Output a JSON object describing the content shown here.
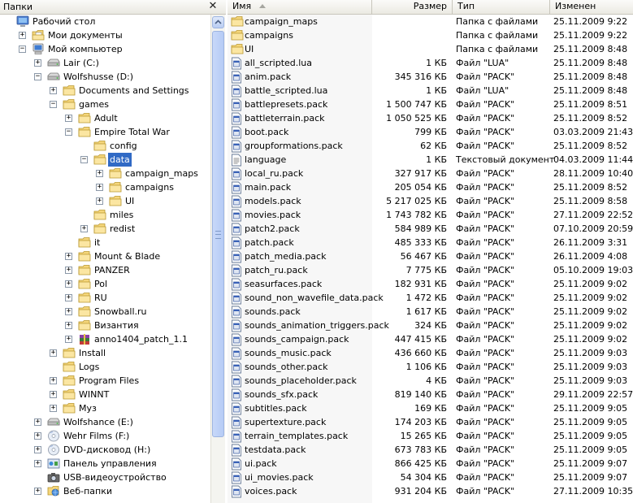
{
  "folders_pane": {
    "title": "Папки",
    "close_glyph": "✕"
  },
  "tree": [
    {
      "label": "Рабочий стол",
      "icon": "desktop-icon",
      "level": 0,
      "expander": ""
    },
    {
      "label": "Мои документы",
      "icon": "documents-icon",
      "level": 1,
      "expander": "+"
    },
    {
      "label": "Мой компьютер",
      "icon": "computer-icon",
      "level": 1,
      "expander": "−"
    },
    {
      "label": "Lair (C:)",
      "icon": "drive-icon",
      "level": 2,
      "expander": "+"
    },
    {
      "label": "Wolfshusse (D:)",
      "icon": "drive-icon",
      "level": 2,
      "expander": "−"
    },
    {
      "label": "Documents and Settings",
      "icon": "folder-icon",
      "level": 3,
      "expander": "+"
    },
    {
      "label": "games",
      "icon": "folder-icon",
      "level": 3,
      "expander": "−"
    },
    {
      "label": "Adult",
      "icon": "folder-icon",
      "level": 4,
      "expander": "+"
    },
    {
      "label": "Empire Total War",
      "icon": "folder-icon",
      "level": 4,
      "expander": "−"
    },
    {
      "label": "config",
      "icon": "folder-icon",
      "level": 5,
      "expander": ""
    },
    {
      "label": "data",
      "icon": "folder-icon",
      "level": 5,
      "expander": "−",
      "selected": true
    },
    {
      "label": "campaign_maps",
      "icon": "folder-icon",
      "level": 6,
      "expander": "+"
    },
    {
      "label": "campaigns",
      "icon": "folder-icon",
      "level": 6,
      "expander": "+"
    },
    {
      "label": "UI",
      "icon": "folder-icon",
      "level": 6,
      "expander": "+"
    },
    {
      "label": "miles",
      "icon": "folder-icon",
      "level": 5,
      "expander": ""
    },
    {
      "label": "redist",
      "icon": "folder-icon",
      "level": 5,
      "expander": "+"
    },
    {
      "label": "it",
      "icon": "folder-icon",
      "level": 4,
      "expander": ""
    },
    {
      "label": "Mount & Blade",
      "icon": "folder-icon",
      "level": 4,
      "expander": "+"
    },
    {
      "label": "PANZER",
      "icon": "folder-icon",
      "level": 4,
      "expander": "+"
    },
    {
      "label": "Pol",
      "icon": "folder-icon",
      "level": 4,
      "expander": "+"
    },
    {
      "label": "RU",
      "icon": "folder-icon",
      "level": 4,
      "expander": "+"
    },
    {
      "label": "Snowball.ru",
      "icon": "folder-icon",
      "level": 4,
      "expander": "+"
    },
    {
      "label": "Византия",
      "icon": "folder-icon",
      "level": 4,
      "expander": "+"
    },
    {
      "label": "anno1404_patch_1.1",
      "icon": "archive-icon",
      "level": 4,
      "expander": "+"
    },
    {
      "label": "Install",
      "icon": "folder-icon",
      "level": 3,
      "expander": "+"
    },
    {
      "label": "Logs",
      "icon": "folder-icon",
      "level": 3,
      "expander": ""
    },
    {
      "label": "Program Files",
      "icon": "folder-icon",
      "level": 3,
      "expander": "+"
    },
    {
      "label": "WINNT",
      "icon": "folder-icon",
      "level": 3,
      "expander": "+"
    },
    {
      "label": "Муз",
      "icon": "folder-icon",
      "level": 3,
      "expander": "+"
    },
    {
      "label": "Wolfshance (E:)",
      "icon": "drive-icon",
      "level": 2,
      "expander": "+"
    },
    {
      "label": "Wehr Films (F:)",
      "icon": "cd-drive-icon",
      "level": 2,
      "expander": "+"
    },
    {
      "label": "DVD-дисковод (H:)",
      "icon": "dvd-drive-icon",
      "level": 2,
      "expander": "+"
    },
    {
      "label": "Панель управления",
      "icon": "control-panel-icon",
      "level": 2,
      "expander": "+"
    },
    {
      "label": "USB-видеоустройство",
      "icon": "camera-icon",
      "level": 2,
      "expander": ""
    },
    {
      "label": "Веб-папки",
      "icon": "web-folder-icon",
      "level": 2,
      "expander": "+"
    }
  ],
  "columns": {
    "name": "Имя",
    "size": "Размер",
    "type": "Тип",
    "modified": "Изменен"
  },
  "files": [
    {
      "name": "campaign_maps",
      "size": "",
      "type": "Папка с файлами",
      "date": "25.11.2009 9:22",
      "icon": "folder-icon"
    },
    {
      "name": "campaigns",
      "size": "",
      "type": "Папка с файлами",
      "date": "25.11.2009 9:22",
      "icon": "folder-icon"
    },
    {
      "name": "UI",
      "size": "",
      "type": "Папка с файлами",
      "date": "25.11.2009 8:48",
      "icon": "folder-icon"
    },
    {
      "name": "all_scripted.lua",
      "size": "1 КБ",
      "type": "Файл \"LUA\"",
      "date": "25.11.2009 8:48",
      "icon": "file-icon"
    },
    {
      "name": "anim.pack",
      "size": "345 316 КБ",
      "type": "Файл \"PACK\"",
      "date": "25.11.2009 8:48",
      "icon": "file-icon"
    },
    {
      "name": "battle_scripted.lua",
      "size": "1 КБ",
      "type": "Файл \"LUA\"",
      "date": "25.11.2009 8:48",
      "icon": "file-icon"
    },
    {
      "name": "battlepresets.pack",
      "size": "1 500 747 КБ",
      "type": "Файл \"PACK\"",
      "date": "25.11.2009 8:51",
      "icon": "file-icon"
    },
    {
      "name": "battleterrain.pack",
      "size": "1 050 525 КБ",
      "type": "Файл \"PACK\"",
      "date": "25.11.2009 8:52",
      "icon": "file-icon"
    },
    {
      "name": "boot.pack",
      "size": "799 КБ",
      "type": "Файл \"PACK\"",
      "date": "03.03.2009 21:43",
      "icon": "file-icon"
    },
    {
      "name": "groupformations.pack",
      "size": "62 КБ",
      "type": "Файл \"PACK\"",
      "date": "25.11.2009 8:52",
      "icon": "file-icon"
    },
    {
      "name": "language",
      "size": "1 КБ",
      "type": "Текстовый документ",
      "date": "04.03.2009 11:44",
      "icon": "text-file-icon"
    },
    {
      "name": "local_ru.pack",
      "size": "327 917 КБ",
      "type": "Файл \"PACK\"",
      "date": "28.11.2009 10:40",
      "icon": "file-icon"
    },
    {
      "name": "main.pack",
      "size": "205 054 КБ",
      "type": "Файл \"PACK\"",
      "date": "25.11.2009 8:52",
      "icon": "file-icon"
    },
    {
      "name": "models.pack",
      "size": "5 217 025 КБ",
      "type": "Файл \"PACK\"",
      "date": "25.11.2009 8:58",
      "icon": "file-icon"
    },
    {
      "name": "movies.pack",
      "size": "1 743 782 КБ",
      "type": "Файл \"PACK\"",
      "date": "27.11.2009 22:52",
      "icon": "file-icon"
    },
    {
      "name": "patch2.pack",
      "size": "584 989 КБ",
      "type": "Файл \"PACK\"",
      "date": "07.10.2009 20:59",
      "icon": "file-icon"
    },
    {
      "name": "patch.pack",
      "size": "485 333 КБ",
      "type": "Файл \"PACK\"",
      "date": "26.11.2009 3:31",
      "icon": "file-icon"
    },
    {
      "name": "patch_media.pack",
      "size": "56 467 КБ",
      "type": "Файл \"PACK\"",
      "date": "26.11.2009 4:08",
      "icon": "file-icon"
    },
    {
      "name": "patch_ru.pack",
      "size": "7 775 КБ",
      "type": "Файл \"PACK\"",
      "date": "05.10.2009 19:03",
      "icon": "file-icon"
    },
    {
      "name": "seasurfaces.pack",
      "size": "182 931 КБ",
      "type": "Файл \"PACK\"",
      "date": "25.11.2009 9:02",
      "icon": "file-icon"
    },
    {
      "name": "sound_non_wavefile_data.pack",
      "size": "1 472 КБ",
      "type": "Файл \"PACK\"",
      "date": "25.11.2009 9:02",
      "icon": "file-icon"
    },
    {
      "name": "sounds.pack",
      "size": "1 617 КБ",
      "type": "Файл \"PACK\"",
      "date": "25.11.2009 9:02",
      "icon": "file-icon"
    },
    {
      "name": "sounds_animation_triggers.pack",
      "size": "324 КБ",
      "type": "Файл \"PACK\"",
      "date": "25.11.2009 9:02",
      "icon": "file-icon"
    },
    {
      "name": "sounds_campaign.pack",
      "size": "447 415 КБ",
      "type": "Файл \"PACK\"",
      "date": "25.11.2009 9:02",
      "icon": "file-icon"
    },
    {
      "name": "sounds_music.pack",
      "size": "436 660 КБ",
      "type": "Файл \"PACK\"",
      "date": "25.11.2009 9:03",
      "icon": "file-icon"
    },
    {
      "name": "sounds_other.pack",
      "size": "1 106 КБ",
      "type": "Файл \"PACK\"",
      "date": "25.11.2009 9:03",
      "icon": "file-icon"
    },
    {
      "name": "sounds_placeholder.pack",
      "size": "4 КБ",
      "type": "Файл \"PACK\"",
      "date": "25.11.2009 9:03",
      "icon": "file-icon"
    },
    {
      "name": "sounds_sfx.pack",
      "size": "819 140 КБ",
      "type": "Файл \"PACK\"",
      "date": "29.11.2009 22:57",
      "icon": "file-icon"
    },
    {
      "name": "subtitles.pack",
      "size": "169 КБ",
      "type": "Файл \"PACK\"",
      "date": "25.11.2009 9:05",
      "icon": "file-icon"
    },
    {
      "name": "supertexture.pack",
      "size": "174 203 КБ",
      "type": "Файл \"PACK\"",
      "date": "25.11.2009 9:05",
      "icon": "file-icon"
    },
    {
      "name": "terrain_templates.pack",
      "size": "15 265 КБ",
      "type": "Файл \"PACK\"",
      "date": "25.11.2009 9:05",
      "icon": "file-icon"
    },
    {
      "name": "testdata.pack",
      "size": "673 783 КБ",
      "type": "Файл \"PACK\"",
      "date": "25.11.2009 9:05",
      "icon": "file-icon"
    },
    {
      "name": "ui.pack",
      "size": "866 425 КБ",
      "type": "Файл \"PACK\"",
      "date": "25.11.2009 9:07",
      "icon": "file-icon"
    },
    {
      "name": "ui_movies.pack",
      "size": "54 304 КБ",
      "type": "Файл \"PACK\"",
      "date": "25.11.2009 9:07",
      "icon": "file-icon"
    },
    {
      "name": "voices.pack",
      "size": "931 204 КБ",
      "type": "Файл \"PACK\"",
      "date": "27.11.2009 10:35",
      "icon": "file-icon"
    }
  ],
  "colors": {
    "selection": "#316ac5",
    "folder": "#f5d67b",
    "header_bg": "#ebeae2"
  }
}
